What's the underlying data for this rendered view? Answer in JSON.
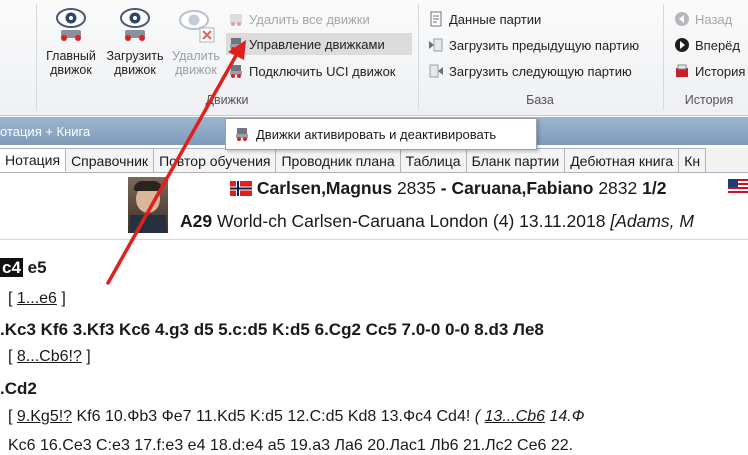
{
  "ribbon": {
    "engines": {
      "main_engine": "Главный\nдвижок",
      "load_engine": "Загрузить\nдвижок",
      "remove_engine": "Удалить\nдвижок",
      "remove_all": "Удалить все движки",
      "manage": "Управление движками",
      "connect_uci": "Подключить UCI движок",
      "group_label": "Движки"
    },
    "database": {
      "game_data": "Данные партии",
      "load_prev": "Загрузить предыдущую партию",
      "load_next": "Загрузить следующую партию",
      "group_label": "База"
    },
    "history": {
      "back": "Назад",
      "forward": "Вперёд",
      "history": "История",
      "group_label": "История"
    }
  },
  "tooltip": "Движки активировать и деактивировать",
  "panel_title": "отация + Книга",
  "tabs": [
    "Нотация",
    "Справочник",
    "Повтор обучения",
    "Проводник плана",
    "Таблица",
    "Бланк партии",
    "Дебютная книга",
    "Кн"
  ],
  "header": {
    "white_name": "Carlsen,Magnus",
    "white_elo": "2835",
    "dash": "-",
    "black_name": "Caruana,Fabiano",
    "black_elo": "2832",
    "result": "1/2",
    "eco": "A29",
    "event": "World-ch Carlsen-Caruana London (4) 13.11.2018",
    "annotator": "[Adams, M"
  },
  "notation": {
    "l1_first": "c4",
    "l1_second": "e5",
    "l2_open": "[",
    "l2_var": "1...e6",
    "l2_close": "]",
    "l3": ".Kc3  Kf6  3.Kf3  Kc6  4.g3  d5  5.c:d5  K:d5  6.Cg2  Cc5  7.0-0  0-0  8.d3  Ле8",
    "l4_open": "[",
    "l4_var": "8...Cb6!?",
    "l4_close": "]",
    "l5": ".Cd2",
    "l6_open": "[",
    "l6_var": "9.Kg5!?",
    "l6_rest": " Kf6  10.Фb3  Фе7  11.Kd5  K:d5  12.C:d5  Kd8  13.Фс4  Cd4! ",
    "l6_ital_open": "( ",
    "l6_ital_var": "13...Cb6",
    "l6_ital_rest": "  14.Ф",
    "l7": "Kc6  16.Ce3  C:e3  17.f:e3  e4  18.d:e4  a5  19.a3  Ла6  20.Лас1  Лb6  21.Лс2  Ce6  22."
  },
  "colors": {
    "accent_red": "#e0201b",
    "title_bar": "#8ea8c5"
  }
}
